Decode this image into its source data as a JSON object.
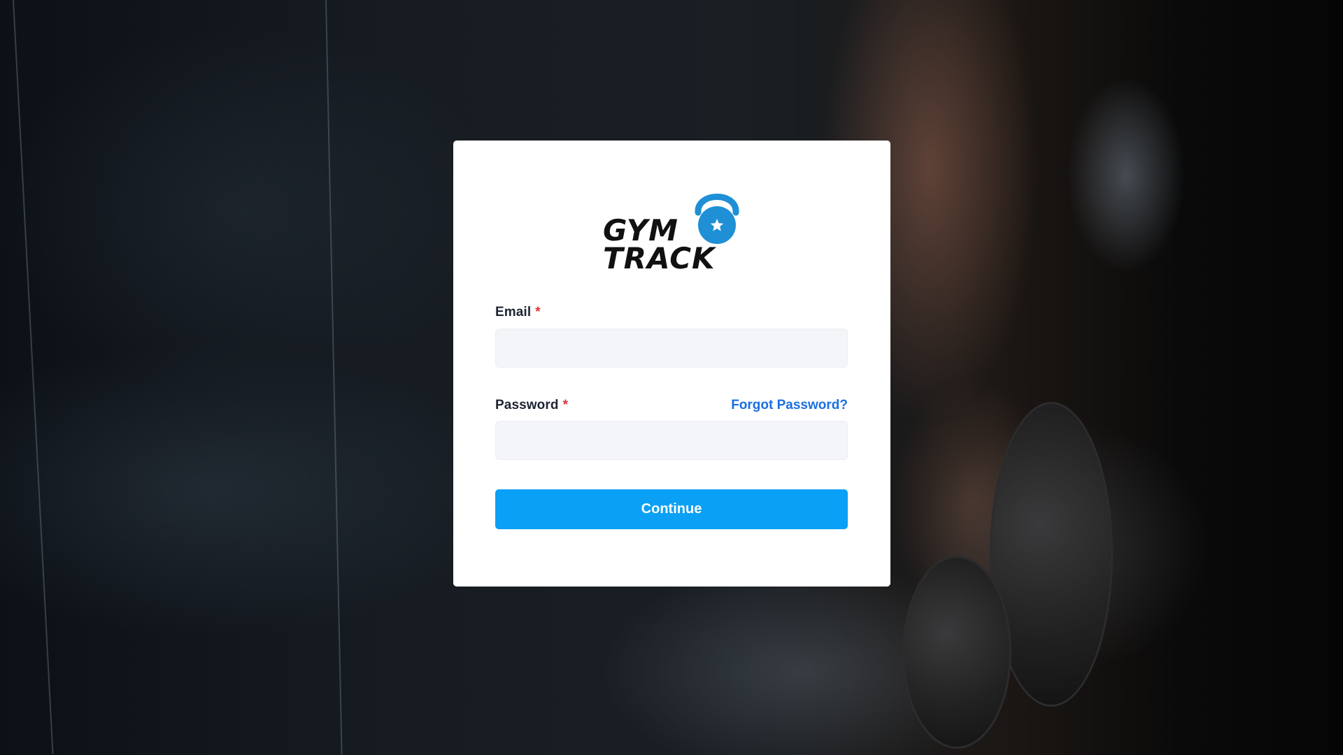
{
  "brand": {
    "line1": "GYM",
    "line2": "TRACK",
    "accent_color": "#1f8fd6",
    "text_color": "#111111"
  },
  "form": {
    "email": {
      "label": "Email",
      "required_mark": "*",
      "value": "",
      "placeholder": ""
    },
    "password": {
      "label": "Password",
      "required_mark": "*",
      "value": "",
      "placeholder": ""
    },
    "forgot_password_label": "Forgot Password?",
    "continue_label": "Continue"
  },
  "colors": {
    "primary_button": "#0aa0f5",
    "link": "#1a6fe0",
    "required": "#e0313b",
    "input_bg": "#f3f5f8",
    "card_bg": "#ffffff"
  },
  "icons": {
    "logo_emblem": "kettlebell-star-icon"
  }
}
